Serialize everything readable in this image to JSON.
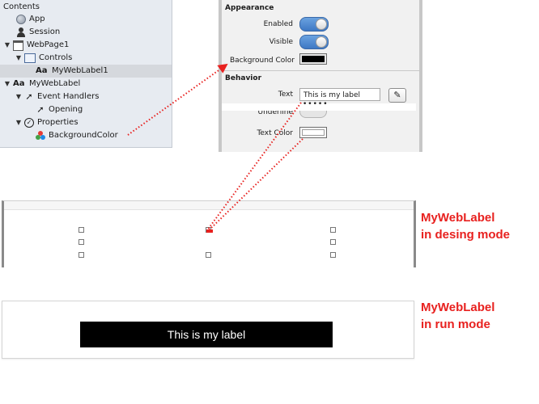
{
  "navigator": {
    "header": "Contents",
    "items": [
      {
        "label": "App"
      },
      {
        "label": "Session"
      },
      {
        "label": "WebPage1"
      },
      {
        "label": "Controls"
      },
      {
        "label": "MyWebLabel1"
      },
      {
        "label": "MyWebLabel"
      },
      {
        "label": "Event Handlers"
      },
      {
        "label": "Opening"
      },
      {
        "label": "Properties"
      },
      {
        "label": "BackgroundColor"
      }
    ]
  },
  "inspector": {
    "appearance_title": "Appearance",
    "enabled_label": "Enabled",
    "visible_label": "Visible",
    "background_color_label": "Background Color",
    "background_color_value": "#000000",
    "behavior_title": "Behavior",
    "text_label": "Text",
    "text_value": "This is my label",
    "underline_label": "Underline",
    "underline_masked": "•••••",
    "text_color_label": "Text Color",
    "text_color_value": "#ffffff"
  },
  "run_label_text": "This is my label",
  "captions": {
    "design_line1": "MyWebLabel",
    "design_line2": "in desing mode",
    "run_line1": "MyWebLabel",
    "run_line2": "in run mode"
  },
  "colors": {
    "annotation_red": "#e8211f",
    "toggle_blue": "#3e78c4"
  }
}
